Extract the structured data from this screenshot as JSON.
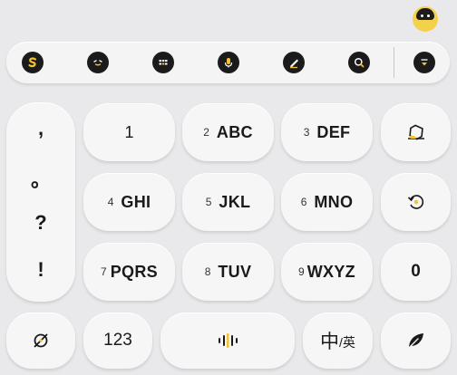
{
  "toolbar": {
    "icons": [
      "sogou-logo-icon",
      "emoji-icon",
      "keyboard-layout-icon",
      "microphone-icon",
      "handwriting-icon",
      "search-icon",
      "collapse-keyboard-icon"
    ]
  },
  "punctuation": [
    ",",
    "。",
    "?",
    "!"
  ],
  "keys": {
    "k1": {
      "digit": "",
      "letters": "1"
    },
    "k2": {
      "digit": "2",
      "letters": "ABC"
    },
    "k3": {
      "digit": "3",
      "letters": "DEF"
    },
    "k4": {
      "digit": "4",
      "letters": "GHI"
    },
    "k5": {
      "digit": "5",
      "letters": "JKL"
    },
    "k6": {
      "digit": "6",
      "letters": "MNO"
    },
    "k7": {
      "digit": "7",
      "letters": "PQRS"
    },
    "k8": {
      "digit": "8",
      "letters": "TUV"
    },
    "k9": {
      "digit": "9",
      "letters": "WXYZ"
    },
    "k0": "0"
  },
  "bottom": {
    "num_label": "123",
    "lang_main": "中",
    "lang_sub": "/英"
  },
  "colors": {
    "accent": "#f2c230",
    "background": "#e9e9eb",
    "key": "#f6f6f7",
    "icon_bg": "#1b1b1b"
  }
}
